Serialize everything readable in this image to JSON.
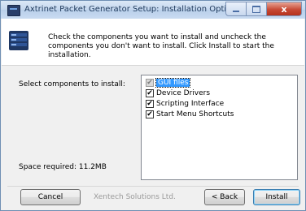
{
  "window": {
    "title": "Axtrinet Packet Generator Setup: Installation Options",
    "close_glyph": "x"
  },
  "header": {
    "instruction": "Check the components you want to install and uncheck the components you don't want to install. Click Install to start the installation."
  },
  "labels": {
    "select_components": "Select components to install:",
    "space_required": "Space required: 11.2MB"
  },
  "components": [
    {
      "label": "GUI files",
      "checked": true,
      "disabled": true,
      "selected": true
    },
    {
      "label": "Device Drivers",
      "checked": true,
      "disabled": false,
      "selected": false
    },
    {
      "label": "Scripting Interface",
      "checked": true,
      "disabled": false,
      "selected": false
    },
    {
      "label": "Start Menu Shortcuts",
      "checked": true,
      "disabled": false,
      "selected": false
    }
  ],
  "footer": {
    "brand": "Xentech Solutions Ltd.",
    "cancel": "Cancel",
    "back": "< Back",
    "install": "Install"
  },
  "check_glyph": "✔"
}
